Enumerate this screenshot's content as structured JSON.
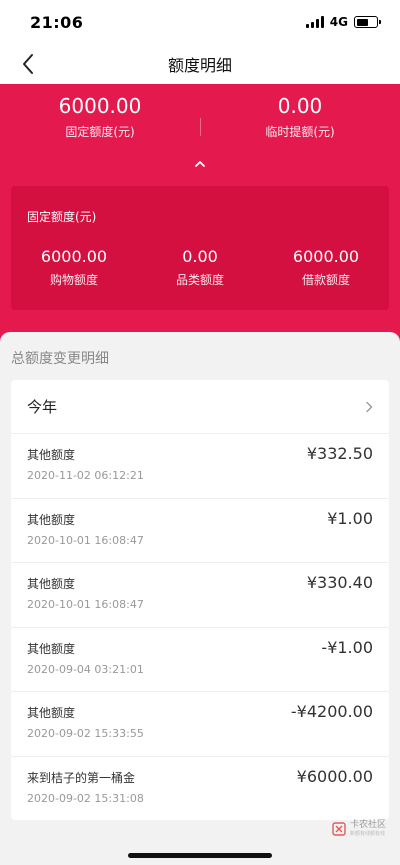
{
  "status_bar": {
    "time": "21:06",
    "network": "4G"
  },
  "nav": {
    "title": "额度明细"
  },
  "header": {
    "fixed": {
      "value": "6000.00",
      "label": "固定额度(元)"
    },
    "temporary": {
      "value": "0.00",
      "label": "临时提额(元)"
    }
  },
  "fixed_card": {
    "title": "固定额度(元)",
    "items": [
      {
        "value": "6000.00",
        "label": "购物额度"
      },
      {
        "value": "0.00",
        "label": "品类额度"
      },
      {
        "value": "6000.00",
        "label": "借款额度"
      }
    ]
  },
  "history": {
    "title": "总额度变更明细",
    "year": "今年",
    "records": [
      {
        "name": "其他额度",
        "time": "2020-11-02 06:12:21",
        "amount": "¥332.50"
      },
      {
        "name": "其他额度",
        "time": "2020-10-01 16:08:47",
        "amount": "¥1.00"
      },
      {
        "name": "其他额度",
        "time": "2020-10-01 16:08:47",
        "amount": "¥330.40"
      },
      {
        "name": "其他额度",
        "time": "2020-09-04 03:21:01",
        "amount": "-¥1.00"
      },
      {
        "name": "其他额度",
        "time": "2020-09-02 15:33:55",
        "amount": "-¥4200.00"
      },
      {
        "name": "来到桔子的第一桶金",
        "time": "2020-09-02 15:31:08",
        "amount": "¥6000.00"
      }
    ]
  },
  "watermark": {
    "main": "卡农社区",
    "sub": "新额有线额有线"
  },
  "colors": {
    "header_red": "#e41a4f",
    "card_red": "#d3103f",
    "panel_bg": "#f2f2f2"
  }
}
